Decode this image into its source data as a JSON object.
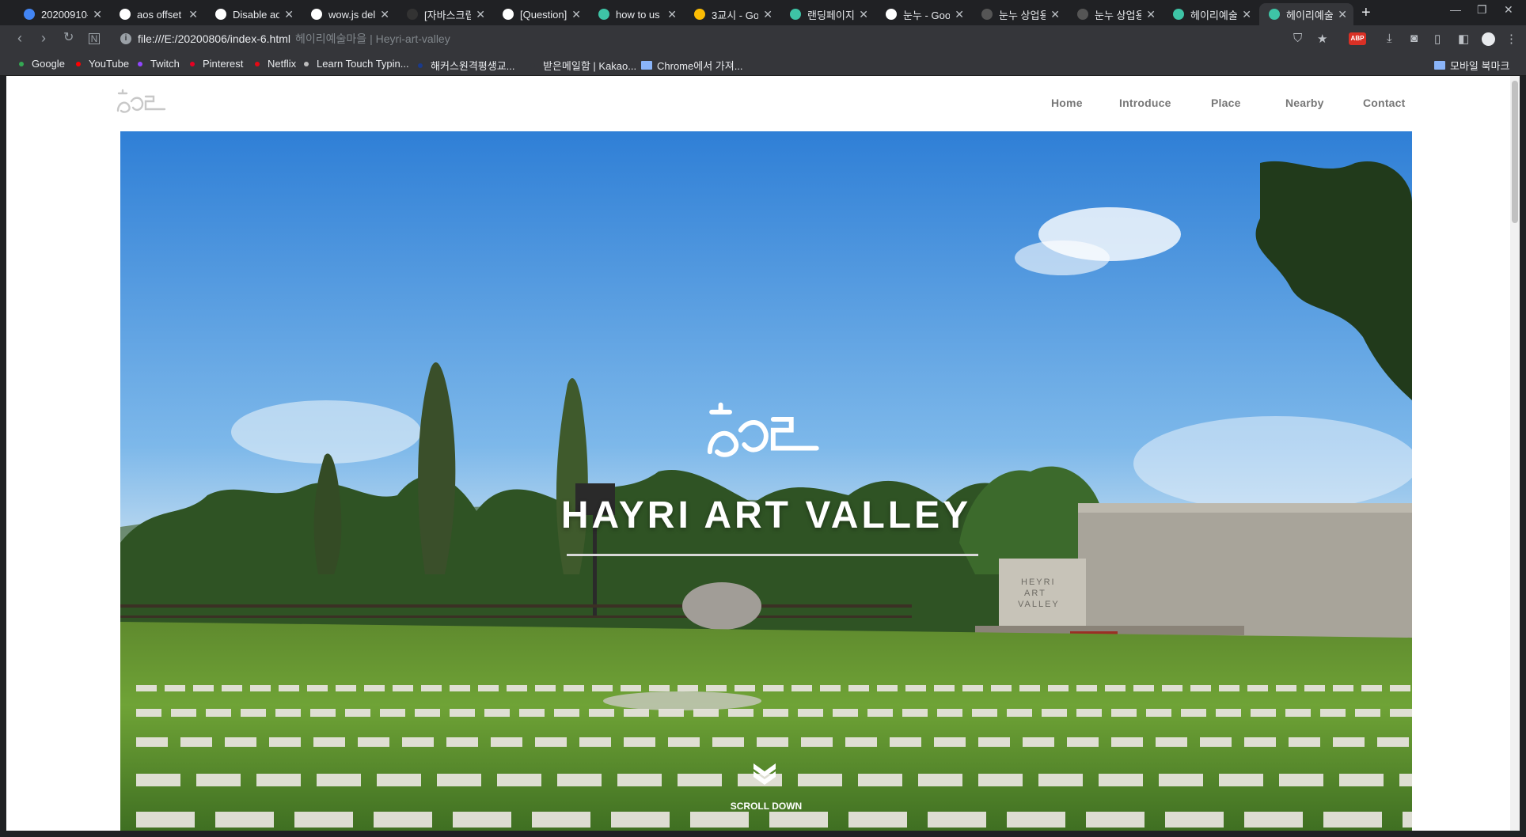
{
  "browser": {
    "tabs": [
      {
        "title": "20200910-",
        "favicon_color": "#4285f4"
      },
      {
        "title": "aos offset",
        "favicon_color": "#ffffff"
      },
      {
        "title": "Disable ao",
        "favicon_color": "#ffffff"
      },
      {
        "title": "wow.js del",
        "favicon_color": "#ffffff"
      },
      {
        "title": "[자바스크립",
        "favicon_color": "#333333"
      },
      {
        "title": "[Question]",
        "favicon_color": "#ffffff"
      },
      {
        "title": "how to us",
        "favicon_color": "#3ec4a6"
      },
      {
        "title": "3교시 - Go",
        "favicon_color": "#fbbc04"
      },
      {
        "title": "랜딩페이지",
        "favicon_color": "#3ec4a6"
      },
      {
        "title": "눈누 - Goo",
        "favicon_color": "#ffffff"
      },
      {
        "title": "눈누 상업용",
        "favicon_color": "#555555"
      },
      {
        "title": "눈누 상업용",
        "favicon_color": "#555555"
      },
      {
        "title": "헤이리예술",
        "favicon_color": "#3ec4a6"
      },
      {
        "title": "헤이리예술",
        "favicon_color": "#3ec4a6",
        "active": true
      }
    ],
    "new_tab_symbol": "+",
    "address": {
      "url": "file:///E:/20200806/index-6.html",
      "page_title": "헤이리예술마을 | Heyri-art-valley"
    },
    "bookmarks": [
      {
        "label": "Google",
        "color": "#34a853"
      },
      {
        "label": "YouTube",
        "color": "#ff0000"
      },
      {
        "label": "Twitch",
        "color": "#9146ff"
      },
      {
        "label": "Pinterest",
        "color": "#e60023"
      },
      {
        "label": "Netflix",
        "color": "#e50914"
      },
      {
        "label": "Learn Touch Typin...",
        "color": "#bdbdbd"
      },
      {
        "label": "해커스원격평생교...",
        "color": "#1a3a8a"
      },
      {
        "label": "받은메일함 | Kakao...",
        "color": "#35363a"
      },
      {
        "label": "Chrome에서 가져...",
        "folder": true
      }
    ],
    "mobile_bookmarks": "모바일 북마크"
  },
  "site": {
    "nav": [
      "Home",
      "Introduce",
      "Place",
      "Nearby",
      "Contact"
    ],
    "hero_title": "HAYRI ART VALLEY",
    "scroll_label": "SCROLL DOWN",
    "building_sign": [
      "HEYRI",
      "ART",
      "VALLEY"
    ]
  }
}
